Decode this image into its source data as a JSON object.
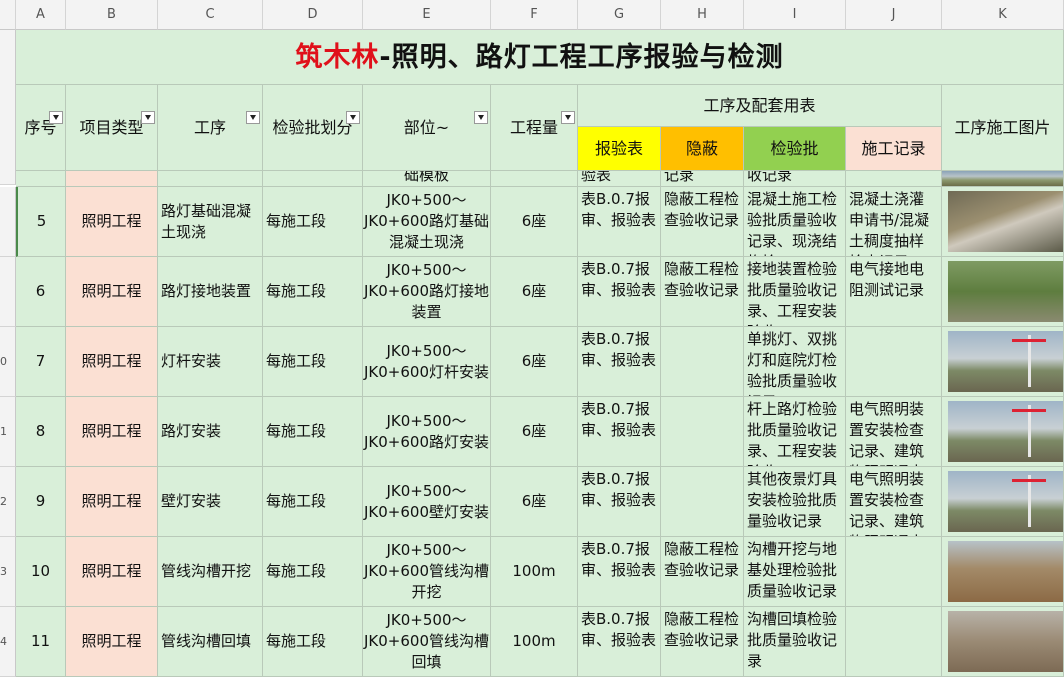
{
  "column_letters": [
    "A",
    "B",
    "C",
    "D",
    "E",
    "F",
    "G",
    "H",
    "I",
    "J",
    "K"
  ],
  "row_numbers": [
    "0",
    "1",
    "2",
    "3",
    "4"
  ],
  "title": {
    "red": "筑木林",
    "rest": "-照明、路灯工程工序报验与检测"
  },
  "headers": {
    "seq": "序号",
    "type": "项目类型",
    "process": "工序",
    "batch": "检验批划分",
    "location": "部位~",
    "quantity": "工程量",
    "forms_group": "工序及配套用表",
    "report_form": "报验表",
    "concealed": "隐蔽",
    "inspection_batch": "检验批",
    "construction_record": "施工记录",
    "photos": "工序施工图片"
  },
  "partial_row": {
    "location": "础模板",
    "report": "验表",
    "concealed": "记录",
    "batch": "收记录"
  },
  "rows": [
    {
      "seq": "5",
      "type": "照明工程",
      "process": "路灯基础混凝土现浇",
      "batch": "每施工段",
      "location": "JK0+500～JK0+600路灯基础混凝土现浇",
      "qty": "6座",
      "report": "表B.0.7报审、报验表",
      "concealed": "隐蔽工程检查验收记录",
      "ibatch": "混凝土施工检验批质量验收记录、现浇结构检",
      "record": "混凝土浇灌申请书/混凝土稠度抽样检查记录"
    },
    {
      "seq": "6",
      "type": "照明工程",
      "process": "路灯接地装置",
      "batch": "每施工段",
      "location": "JK0+500～JK0+600路灯接地装置",
      "qty": "6座",
      "report": "表B.0.7报审、报验表",
      "concealed": "隐蔽工程检查验收记录",
      "ibatch": "接地装置检验批质量验收记录、工程安装验收",
      "record": "电气接地电阻测试记录"
    },
    {
      "seq": "7",
      "type": "照明工程",
      "process": "灯杆安装",
      "batch": "每施工段",
      "location": "JK0+500～JK0+600灯杆安装",
      "qty": "6座",
      "report": "表B.0.7报审、报验表",
      "concealed": "",
      "ibatch": "单挑灯、双挑灯和庭院灯检验批质量验收记录",
      "record": ""
    },
    {
      "seq": "8",
      "type": "照明工程",
      "process": "路灯安装",
      "batch": "每施工段",
      "location": "JK0+500～JK0+600路灯安装",
      "qty": "6座",
      "report": "表B.0.7报审、报验表",
      "concealed": "",
      "ibatch": "杆上路灯检验批质量验收记录、工程安装验收",
      "record": "电气照明装置安装检查记录、建筑物照明通电"
    },
    {
      "seq": "9",
      "type": "照明工程",
      "process": "壁灯安装",
      "batch": "每施工段",
      "location": "JK0+500～JK0+600壁灯安装",
      "qty": "6座",
      "report": "表B.0.7报审、报验表",
      "concealed": "",
      "ibatch": "其他夜景灯具安装检验批质量验收记录",
      "record": "电气照明装置安装检查记录、建筑物照明通电"
    },
    {
      "seq": "10",
      "type": "照明工程",
      "process": "管线沟槽开挖",
      "batch": "每施工段",
      "location": "JK0+500～JK0+600管线沟槽开挖",
      "qty": "100m",
      "report": "表B.0.7报审、报验表",
      "concealed": "隐蔽工程检查验收记录",
      "ibatch": "沟槽开挖与地基处理检验批质量验收记录",
      "record": ""
    },
    {
      "seq": "11",
      "type": "照明工程",
      "process": "管线沟槽回填",
      "batch": "每施工段",
      "location": "JK0+500～JK0+600管线沟槽回填",
      "qty": "100m",
      "report": "表B.0.7报审、报验表",
      "concealed": "隐蔽工程检查验收记录",
      "ibatch": "沟槽回填检验批质量验收记录",
      "record": ""
    }
  ],
  "colors": {
    "green": "#d9efd9",
    "pink": "#fbe0d3",
    "yellow": "#ffff00",
    "orange": "#ffbf00",
    "lime": "#92d050",
    "title_red": "#e0101a"
  }
}
